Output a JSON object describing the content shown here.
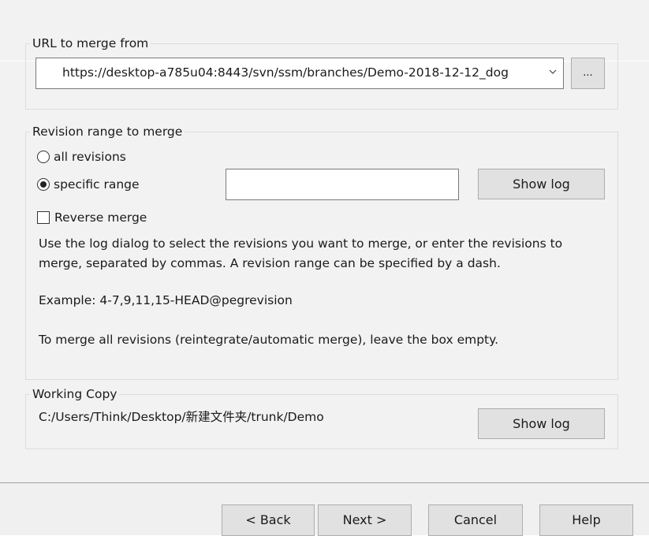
{
  "url_group": {
    "label": "URL to merge from",
    "url_value": "https://desktop-a785u04:8443/svn/ssm/branches/Demo-2018-12-12_dog",
    "browse_label": "..."
  },
  "revision_group": {
    "label": "Revision range to merge",
    "all_revisions_label": "all revisions",
    "specific_range_label": "specific range",
    "range_value": "",
    "show_log_label": "Show log",
    "reverse_merge_label": "Reverse merge",
    "help_line1": "Use the log dialog to select the revisions you want to merge, or enter the revisions to",
    "help_line2": "merge, separated by commas. A revision range can be specified by a dash.",
    "example": "Example: 4-7,9,11,15-HEAD@pegrevision",
    "empty_note": "To merge all revisions (reintegrate/automatic merge), leave the box empty."
  },
  "working_copy": {
    "label": "Working Copy",
    "path": "C:/Users/Think/Desktop/新建文件夹/trunk/Demo",
    "show_log_label": "Show log"
  },
  "footer": {
    "back_label": "< Back",
    "next_label": "Next >",
    "cancel_label": "Cancel",
    "help_label": "Help"
  }
}
